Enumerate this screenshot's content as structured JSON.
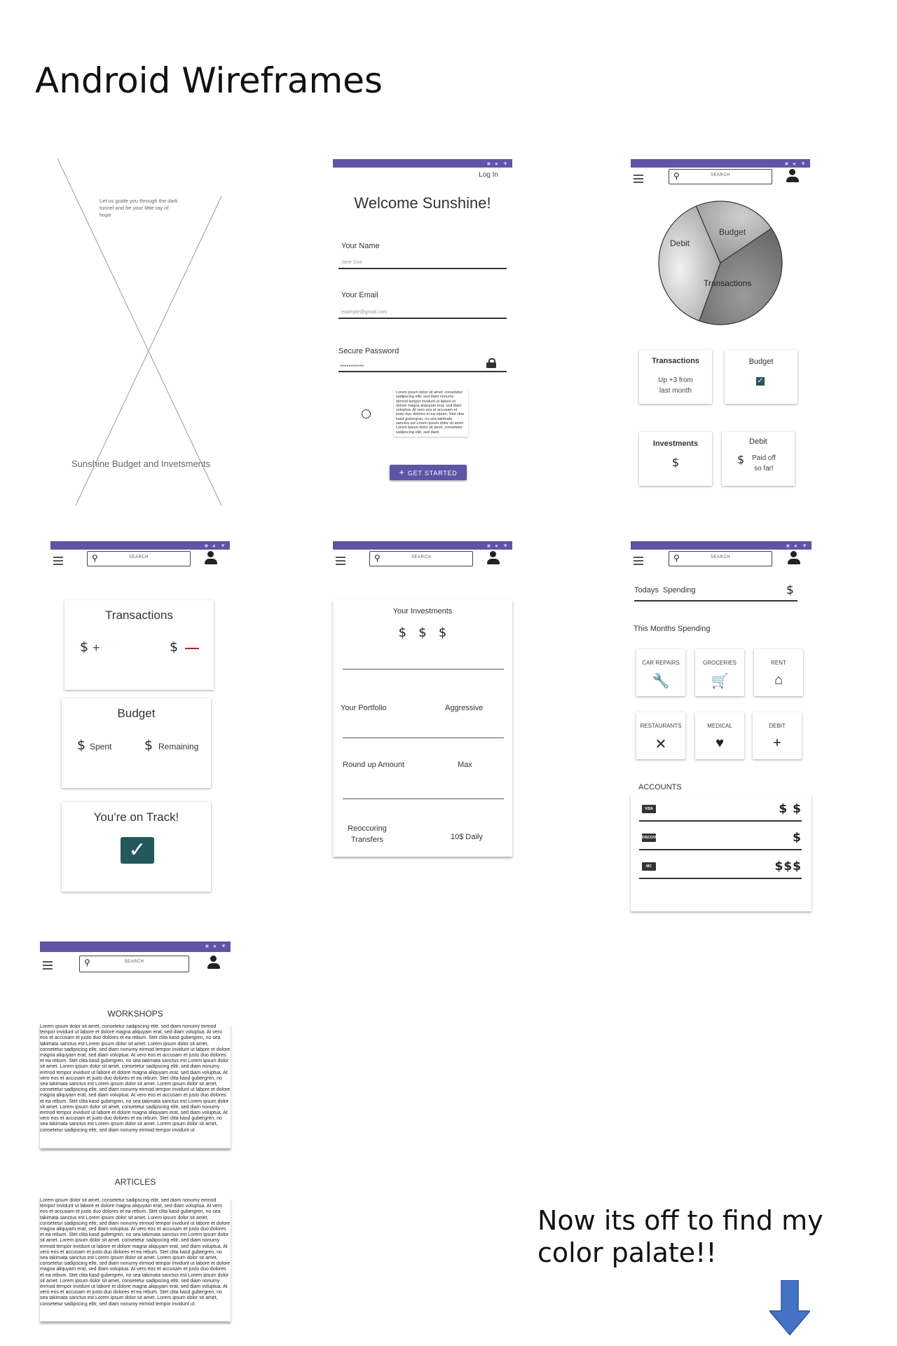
{
  "page_title": "Android Wireframes",
  "footer_note": "Now its off to find my color palate!!",
  "colors": {
    "statusbar": "#5e55a6",
    "primary_button": "#5e55a6",
    "check_accent": "#23585c",
    "minus_red": "#b22",
    "arrow_blue": "#4472c4"
  },
  "status_icons": "■ ● ▼",
  "search_placeholder": "SEARCH",
  "splash": {
    "tagline": "Let us guide you through the dark tunnel and be your little ray of hope",
    "app_name": "Sunshine Budget and Invetsments"
  },
  "login": {
    "log_in": "Log In",
    "welcome": "Welcome Sunshine!",
    "name_label": "Your Name",
    "name_placeholder": "Jane Doe",
    "email_label": "Your Email",
    "email_placeholder": "example@gmail.com",
    "password_label": "Secure Password",
    "password_value": "***********",
    "terms_text": "Lorem ipsum dolor sit amet, consetetur sadipscing elitr, sed diam nonumy eirmod tempor invidunt ut labore et dolore magna aliquyam erat, sed diam voluptua. At vero eos et accusam et justo duo dolores et ea rebum. Stet clita kasd gubergren, no sea takimata sanctus est Lorem ipsum dolor sit amet. Lorem ipsum dolor sit amet, consetetur sadipscing elitr, sed diam",
    "get_started": "GET STARTED"
  },
  "dashboard": {
    "pie_labels": {
      "debit": "Debit",
      "budget": "Budget",
      "transactions": "Transactions"
    },
    "chart_data": {
      "type": "pie",
      "categories": [
        "Debit",
        "Budget",
        "Transactions"
      ],
      "values": [
        38,
        22,
        40
      ]
    },
    "cards": {
      "transactions_title": "Transactions",
      "transactions_sub": "Up +3 from last month",
      "budget_title": "Budget",
      "investments_title": "Investments",
      "investments_symbol": "$",
      "debit_title": "Debit",
      "debit_symbol": "$",
      "debit_sub": "Paid off so far!"
    }
  },
  "overview": {
    "transactions_title": "Transactions",
    "dollar": "$",
    "plus": "+",
    "budget_title": "Budget",
    "spent": "Spent",
    "remaining": "Remaining",
    "on_track": "You're on Track!"
  },
  "investments": {
    "title": "Your Investments",
    "dollars": "$   $   $",
    "portfolio_label": "Your Portfolio",
    "portfolio_value": "Aggressive",
    "roundup_label": "Round up Amount",
    "roundup_value": "Max",
    "transfers_label": "Reoccuring Transfers",
    "transfers_value": "10$ Daily"
  },
  "spending": {
    "todays": "Todays  Spending",
    "dollar": "$",
    "months": "This Months Spending",
    "tiles": [
      {
        "label": "CAR REPAIRS",
        "icon": "wrench-icon",
        "glyph": "🔧"
      },
      {
        "label": "GROCERIES",
        "icon": "cart-icon",
        "glyph": "🛒"
      },
      {
        "label": "RENT",
        "icon": "home-icon",
        "glyph": "⌂"
      },
      {
        "label": "RESTAURANTS",
        "icon": "utensils-icon",
        "glyph": "✕"
      },
      {
        "label": "MEDICAL",
        "icon": "heart-pulse-icon",
        "glyph": "♥"
      },
      {
        "label": "DEBIT",
        "icon": "plus-icon",
        "glyph": "+"
      }
    ],
    "accounts_label": "ACCOUNTS",
    "accounts": [
      {
        "card": "VISA",
        "amount": "$ $"
      },
      {
        "card": "DISCOVER",
        "amount": "$"
      },
      {
        "card": "MC",
        "amount": "$$$"
      }
    ]
  },
  "learn": {
    "workshops": "WORKSHOPS",
    "articles": "ARTICLES",
    "lorem": "Lorem ipsum dolor sit amet, consetetur sadipscing elitr, sed diam nonumy eirmod tempor invidunt ut labore et dolore magna aliquyam erat, sed diam voluptua. At vero eos et accusam et justo duo dolores et ea rebum. Stet clita kasd gubergren, no sea takimata sanctus est Lorem ipsum dolor sit amet. Lorem ipsum dolor sit amet, consetetur sadipscing elitr, sed diam nonumy eirmod tempor invidunt ut labore et dolore magna aliquyam erat, sed diam voluptua. At vero eos et accusam et justo duo dolores et ea rebum. Stet clita kasd gubergren, no sea takimata sanctus est Lorem ipsum dolor sit amet. Lorem ipsum dolor sit amet, consetetur sadipscing elitr, sed diam nonumy eirmod tempor invidunt ut labore et dolore magna aliquyam erat, sed diam voluptua. At vero eos et accusam et justo duo dolores et ea rebum. Stet clita kasd gubergren, no sea takimata sanctus est Lorem ipsum dolor sit amet. Lorem ipsum dolor sit amet, consetetur sadipscing elitr, sed diam nonumy eirmod tempor invidunt ut labore et dolore magna aliquyam erat, sed diam voluptua. At vero eos et accusam et justo duo dolores et ea rebum. Stet clita kasd gubergren, no sea takimata sanctus est Lorem ipsum dolor sit amet. Lorem ipsum dolor sit amet, consetetur sadipscing elitr, sed diam nonumy eirmod tempor invidunt ut labore et dolore magna aliquyam erat, sed diam voluptua. At vero eos et accusam et justo duo dolores et ea rebum. Stet clita kasd gubergren, no sea takimata sanctus est Lorem ipsum dolor sit amet. Lorem ipsum dolor sit amet, consetetur sadipscing elitr, sed diam nonumy eirmod tempor invidunt ut"
  }
}
